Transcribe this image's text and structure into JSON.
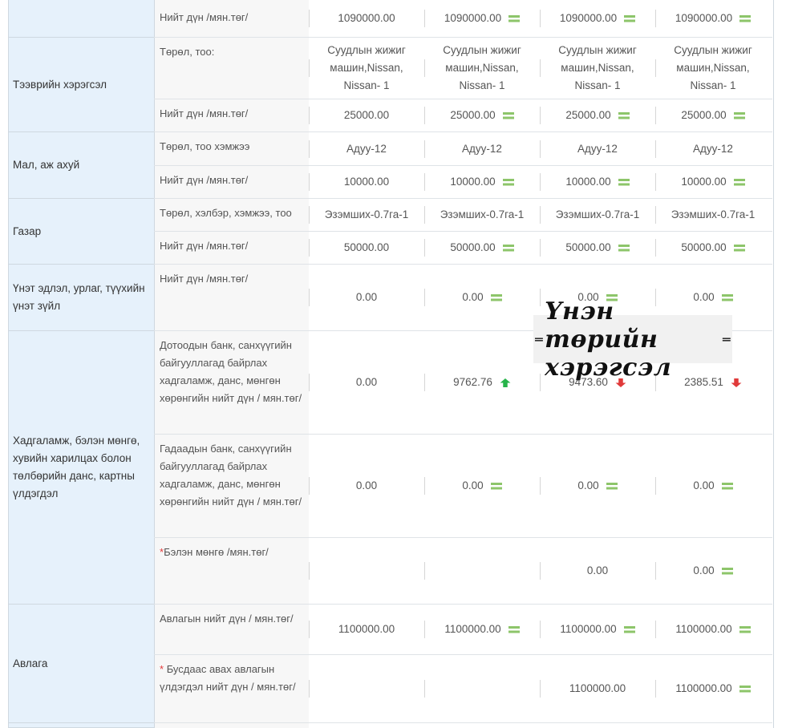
{
  "total_label": "Нийт дүн /мян.төг/",
  "categories": {
    "vehicles": "Тээврийн хэрэгсэл",
    "livestock": "Мал, аж ахуй",
    "land": "Газар",
    "valuables": "Үнэт эдлэл, урлаг, түүхийн үнэт зүйл",
    "savings": "Хадгаламж, бэлэн мөнгө, хувийн харилцах болон төлбөрийн данс, картны үлдэгдэл",
    "receivables": "Авлага"
  },
  "labels": {
    "vehicle_type": "Төрөл, тоо:",
    "livestock_type": "Төрөл, тоо хэмжээ",
    "land_type": "Төрөл, хэлбэр, хэмжээ, тоо",
    "domestic_bank": "Дотоодын банк, санхүүгийн байгууллагад байрлах хадгаламж, данс, мөнгөн хөрөнгийн нийт дүн / мян.төг/",
    "foreign_bank": "Гадаадын банк, санхүүгийн байгууллагад байрлах хадгаламж, данс, мөнгөн хөрөнгийн нийт дүн / мян.төг/",
    "cash": "Бэлэн мөнгө /мян.төг/",
    "receivable_total": "Авлагын нийт дүн / мян.төг/",
    "receivable_others": "Бусдаас авах авлагын үлдэгдэл нийт дүн / мян.төг/",
    "required_mark": "*"
  },
  "rows": {
    "top_total": [
      "1090000.00",
      "1090000.00",
      "1090000.00",
      "1090000.00"
    ],
    "vehicle_type": [
      "Суудлын жижиг машин,Nissan, Nissan- 1",
      "Суудлын жижиг машин,Nissan, Nissan- 1",
      "Суудлын жижиг машин,Nissan, Nissan- 1",
      "Суудлын жижиг машин,Nissan, Nissan- 1"
    ],
    "vehicle_total": [
      "25000.00",
      "25000.00",
      "25000.00",
      "25000.00"
    ],
    "livestock_type": [
      "Адуу-12",
      "Адуу-12",
      "Адуу-12",
      "Адуу-12"
    ],
    "livestock_total": [
      "10000.00",
      "10000.00",
      "10000.00",
      "10000.00"
    ],
    "land_type": [
      "Эзэмших-0.7га-1",
      "Эзэмших-0.7га-1",
      "Эзэмших-0.7га-1",
      "Эзэмших-0.7га-1"
    ],
    "land_total": [
      "50000.00",
      "50000.00",
      "50000.00",
      "50000.00"
    ],
    "valuables_total": [
      "0.00",
      "0.00",
      "0.00",
      "0.00"
    ],
    "domestic_bank": [
      "0.00",
      "9762.76",
      "9473.60",
      "2385.51"
    ],
    "foreign_bank": [
      "0.00",
      "0.00",
      "0.00",
      "0.00"
    ],
    "cash": [
      "",
      "",
      "0.00",
      "0.00"
    ],
    "receivable_total": [
      "1100000.00",
      "1100000.00",
      "1100000.00",
      "1100000.00"
    ],
    "receivable_others": [
      "",
      "",
      "1100000.00",
      "1100000.00"
    ]
  },
  "watermark": {
    "text": "Үнэн төрийн хэрэгсэл"
  },
  "colors": {
    "category_bg": "#e6f1fb",
    "label_bg": "#f7f7f7",
    "equal_icon": "#8dc56a",
    "increase_icon": "#27b34a",
    "decrease_icon": "#e03a3a",
    "required": "#e23b3b"
  }
}
